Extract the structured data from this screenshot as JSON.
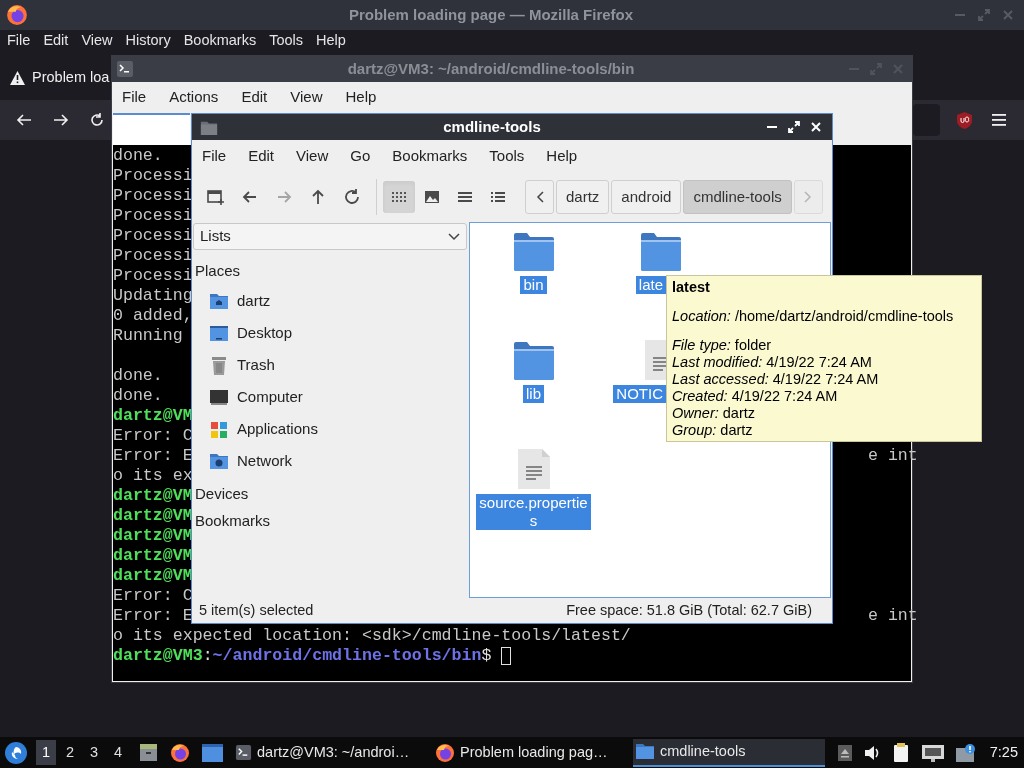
{
  "firefox": {
    "title": "Problem loading page — Mozilla Firefox",
    "menu": [
      "File",
      "Edit",
      "View",
      "History",
      "Bookmarks",
      "Tools",
      "Help"
    ],
    "tab": {
      "label": "Problem loa"
    }
  },
  "terminal": {
    "title": "dartz@VM3: ~/android/cmdline-tools/bin",
    "menu": [
      "File",
      "Actions",
      "Edit",
      "View",
      "Help"
    ],
    "lines": [
      {
        "kind": "output",
        "text": "done."
      },
      {
        "kind": "output",
        "text": "Processi"
      },
      {
        "kind": "output",
        "text": "Processi"
      },
      {
        "kind": "output",
        "text": "Processi"
      },
      {
        "kind": "output",
        "text": "Processi"
      },
      {
        "kind": "output",
        "text": "Processi"
      },
      {
        "kind": "output",
        "text": "Processi"
      },
      {
        "kind": "output",
        "text": "Updating"
      },
      {
        "kind": "output",
        "text": "0 added,"
      },
      {
        "kind": "output",
        "text": "Running"
      },
      {
        "kind": "blank"
      },
      {
        "kind": "output",
        "text": "done."
      },
      {
        "kind": "output",
        "text": "done."
      },
      {
        "kind": "prompt",
        "user": "dartz@VM"
      },
      {
        "kind": "output",
        "text": "Error: C"
      },
      {
        "kind": "output",
        "text": "Error: E",
        "right": "e int"
      },
      {
        "kind": "output",
        "text": "o its ex"
      },
      {
        "kind": "prompt",
        "user": "dartz@VM"
      },
      {
        "kind": "prompt",
        "user": "dartz@VM"
      },
      {
        "kind": "prompt",
        "user": "dartz@VM"
      },
      {
        "kind": "prompt",
        "user": "dartz@VM"
      },
      {
        "kind": "prompt",
        "user": "dartz@VM"
      },
      {
        "kind": "output",
        "text": "Error: C"
      },
      {
        "kind": "output",
        "text": "Error: E",
        "right": "e int"
      },
      {
        "kind": "output",
        "text": "o its expected location: <sdk>/cmdline-tools/latest/"
      },
      {
        "kind": "prompt",
        "user": "dartz@VM3",
        "sep": ":",
        "path": "~/android/cmdline-tools/bin",
        "symbol": "$",
        "cursor": true
      }
    ]
  },
  "file_manager": {
    "title": "cmdline-tools",
    "menu": [
      "File",
      "Edit",
      "View",
      "Go",
      "Bookmarks",
      "Tools",
      "Help"
    ],
    "toolbar": [
      {
        "kind": "new-tab",
        "disabled": false
      },
      {
        "kind": "back",
        "disabled": false
      },
      {
        "kind": "forward",
        "disabled": true
      },
      {
        "kind": "up",
        "disabled": false
      },
      {
        "kind": "reload",
        "disabled": false
      }
    ],
    "views": [
      {
        "kind": "icons",
        "selected": true
      },
      {
        "kind": "thumbnails",
        "selected": false
      },
      {
        "kind": "compact",
        "selected": false
      },
      {
        "kind": "details",
        "selected": false
      }
    ],
    "path": {
      "back_disabled": false,
      "forward_disabled": true,
      "crumbs": [
        {
          "label": "dartz",
          "selected": false
        },
        {
          "label": "android",
          "selected": false
        },
        {
          "label": "cmdline-tools",
          "selected": true
        }
      ]
    },
    "sidebar": {
      "dropdown": "Lists",
      "sections": [
        {
          "title": "Places",
          "items": [
            {
              "label": "dartz",
              "kind": "home"
            },
            {
              "label": "Desktop",
              "kind": "desktop"
            },
            {
              "label": "Trash",
              "kind": "trash"
            },
            {
              "label": "Computer",
              "kind": "computer"
            },
            {
              "label": "Applications",
              "kind": "applications"
            },
            {
              "label": "Network",
              "kind": "network"
            }
          ]
        },
        {
          "title": "Devices"
        },
        {
          "title": "Bookmarks"
        }
      ]
    },
    "files": [
      {
        "name": "bin",
        "kind": "folder",
        "selected": true
      },
      {
        "name": "late",
        "kind": "folder",
        "selected": true
      },
      {
        "name": "lib",
        "kind": "folder",
        "selected": true
      },
      {
        "name": "NOTIC",
        "kind": "document",
        "selected": true
      },
      {
        "name": "source.propertie s",
        "kind": "document",
        "selected": true
      }
    ],
    "status": {
      "selection": "5 item(s) selected",
      "free_space": "Free space: 51.8 GiB (Total: 62.7 GiB)"
    },
    "tooltip": {
      "title": "latest",
      "groups": [
        [
          {
            "label": "Location:",
            "value": "/home/dartz/android/cmdline-tools"
          }
        ],
        [
          {
            "label": "File type:",
            "value": "folder"
          },
          {
            "label": "Last modified:",
            "value": "4/19/22 7:24 AM"
          },
          {
            "label": "Last accessed:",
            "value": "4/19/22 7:24 AM"
          },
          {
            "label": "Created:",
            "value": "4/19/22 7:24 AM"
          },
          {
            "label": "Owner:",
            "value": "dartz"
          },
          {
            "label": "Group:",
            "value": "dartz"
          }
        ]
      ]
    }
  },
  "taskbar": {
    "workspaces": [
      {
        "label": "1",
        "selected": true
      },
      {
        "label": "2",
        "selected": false
      },
      {
        "label": "3",
        "selected": false
      },
      {
        "label": "4",
        "selected": false
      }
    ],
    "launchers": [
      {
        "kind": "files"
      },
      {
        "kind": "browser"
      },
      {
        "kind": "desktop"
      }
    ],
    "tasks": [
      {
        "kind": "terminal",
        "label": "dartz@VM3: ~/androi…",
        "selected": false
      },
      {
        "kind": "browser",
        "label": "Problem loading pag…",
        "selected": false
      },
      {
        "kind": "folder",
        "label": "cmdline-tools",
        "selected": true
      }
    ],
    "tray": [
      {
        "kind": "up"
      },
      {
        "kind": "volume"
      },
      {
        "kind": "clipboard"
      },
      {
        "kind": "network"
      },
      {
        "kind": "notification"
      }
    ],
    "clock": "7:25"
  }
}
